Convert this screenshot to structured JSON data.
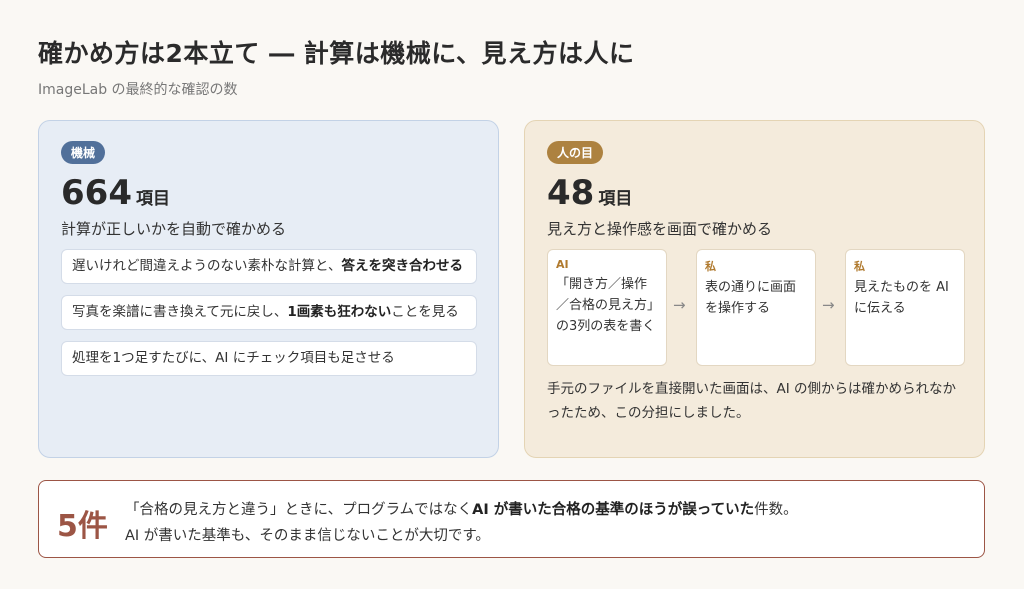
{
  "header": {
    "title": "確かめ方は2本立て ― 計算は機械に、見え方は人に",
    "subtitle": "ImageLab の最終的な確認の数"
  },
  "machine": {
    "badge": "機械",
    "count": "664",
    "unit": "項目",
    "description": "計算が正しいかを自動で確かめる",
    "checks": [
      {
        "text": "遅いけれど間違えようのない素朴な計算と、",
        "bold": "答えを突き合わせる",
        "after": ""
      },
      {
        "text": "写真を楽譜に書き換えて元に戻し、",
        "bold": "1画素も狂わない",
        "after": "ことを見る"
      },
      {
        "text": "処理を1つ足すたびに、AI にチェック項目も足させる",
        "bold": "",
        "after": ""
      }
    ]
  },
  "human": {
    "badge": "人の目",
    "count": "48",
    "unit": "項目",
    "description": "見え方と操作感を画面で確かめる",
    "steps": [
      {
        "who": "AI",
        "what": "「開き方／操作／合格の見え方」の3列の表を書く"
      },
      {
        "who": "私",
        "what": "表の通りに画面を操作する"
      },
      {
        "who": "私",
        "what": "見えたものを AI に伝える"
      }
    ],
    "arrow": "→",
    "note": "手元のファイルを直接開いた画面は、AI の側からは確かめられなかったため、この分担にしました。"
  },
  "summary": {
    "count": "5件",
    "line1_pre": "「合格の見え方と違う」ときに、プログラムではなく",
    "line1_bold": "AI が書いた合格の基準のほうが誤っていた",
    "line1_post": "件数。",
    "line2": "AI が書いた基準も、そのまま信じないことが大切です。"
  },
  "colors": {
    "machine_bg": "#e7edf5",
    "human_bg": "#f4ebdc",
    "accent_blue": "#51709a",
    "accent_gold": "#ad8240",
    "accent_red": "#9c5545"
  }
}
